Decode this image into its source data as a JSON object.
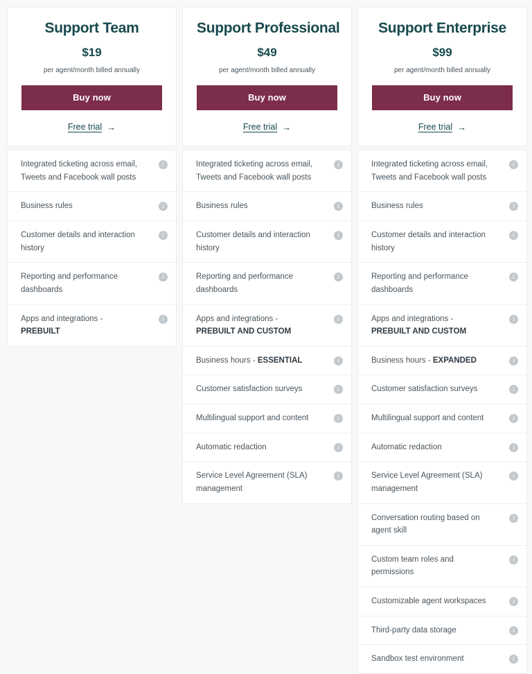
{
  "page": {
    "background_color": "#f7f8f8",
    "accent_color": "#7c2d4b",
    "heading_color": "#17494d",
    "body_text_color": "#49545c"
  },
  "icons": {
    "info": "i",
    "arrow_right": "→",
    "info_icon_name": "info-icon",
    "arrow_icon_name": "arrow-right-icon"
  },
  "plans": [
    {
      "id": "support-team",
      "name": "Support Team",
      "price": "$19",
      "billing": "per agent/month billed annually",
      "buy_label": "Buy now",
      "trial_label": "Free trial",
      "trial_arrow": "→",
      "features": [
        {
          "text": "Integrated ticketing across email, Tweets and Facebook wall posts",
          "emphasis": ""
        },
        {
          "text": "Business rules",
          "emphasis": ""
        },
        {
          "text": "Customer details and interaction history",
          "emphasis": ""
        },
        {
          "text": "Reporting and performance dashboards",
          "emphasis": ""
        },
        {
          "text": "Apps and integrations - ",
          "emphasis": "PREBUILT"
        }
      ]
    },
    {
      "id": "support-professional",
      "name": "Support Professional",
      "price": "$49",
      "billing": "per agent/month billed annually",
      "buy_label": "Buy now",
      "trial_label": "Free trial",
      "trial_arrow": "→",
      "features": [
        {
          "text": "Integrated ticketing across email, Tweets and Facebook wall posts",
          "emphasis": ""
        },
        {
          "text": "Business rules",
          "emphasis": ""
        },
        {
          "text": "Customer details and interaction history",
          "emphasis": ""
        },
        {
          "text": "Reporting and performance dashboards",
          "emphasis": ""
        },
        {
          "text": "Apps and integrations - ",
          "emphasis": "PREBUILT AND CUSTOM"
        },
        {
          "text": "Business hours - ",
          "emphasis": "ESSENTIAL"
        },
        {
          "text": "Customer satisfaction surveys",
          "emphasis": ""
        },
        {
          "text": "Multilingual support and content",
          "emphasis": ""
        },
        {
          "text": "Automatic redaction",
          "emphasis": ""
        },
        {
          "text": "Service Level Agreement (SLA) management",
          "emphasis": ""
        }
      ]
    },
    {
      "id": "support-enterprise",
      "name": "Support Enterprise",
      "price": "$99",
      "billing": "per agent/month billed annually",
      "buy_label": "Buy now",
      "trial_label": "Free trial",
      "trial_arrow": "→",
      "features": [
        {
          "text": "Integrated ticketing across email, Tweets and Facebook wall posts",
          "emphasis": ""
        },
        {
          "text": "Business rules",
          "emphasis": ""
        },
        {
          "text": "Customer details and interaction history",
          "emphasis": ""
        },
        {
          "text": "Reporting and performance dashboards",
          "emphasis": ""
        },
        {
          "text": "Apps and integrations - ",
          "emphasis": "PREBUILT AND CUSTOM"
        },
        {
          "text": "Business hours - ",
          "emphasis": "EXPANDED"
        },
        {
          "text": "Customer satisfaction surveys",
          "emphasis": ""
        },
        {
          "text": "Multilingual support and content",
          "emphasis": ""
        },
        {
          "text": "Automatic redaction",
          "emphasis": ""
        },
        {
          "text": "Service Level Agreement (SLA) management",
          "emphasis": ""
        },
        {
          "text": "Conversation routing based on agent skill",
          "emphasis": ""
        },
        {
          "text": "Custom team roles and permissions",
          "emphasis": ""
        },
        {
          "text": "Customizable agent workspaces",
          "emphasis": ""
        },
        {
          "text": "Third-party data storage",
          "emphasis": ""
        },
        {
          "text": "Sandbox test environment",
          "emphasis": ""
        }
      ]
    }
  ]
}
